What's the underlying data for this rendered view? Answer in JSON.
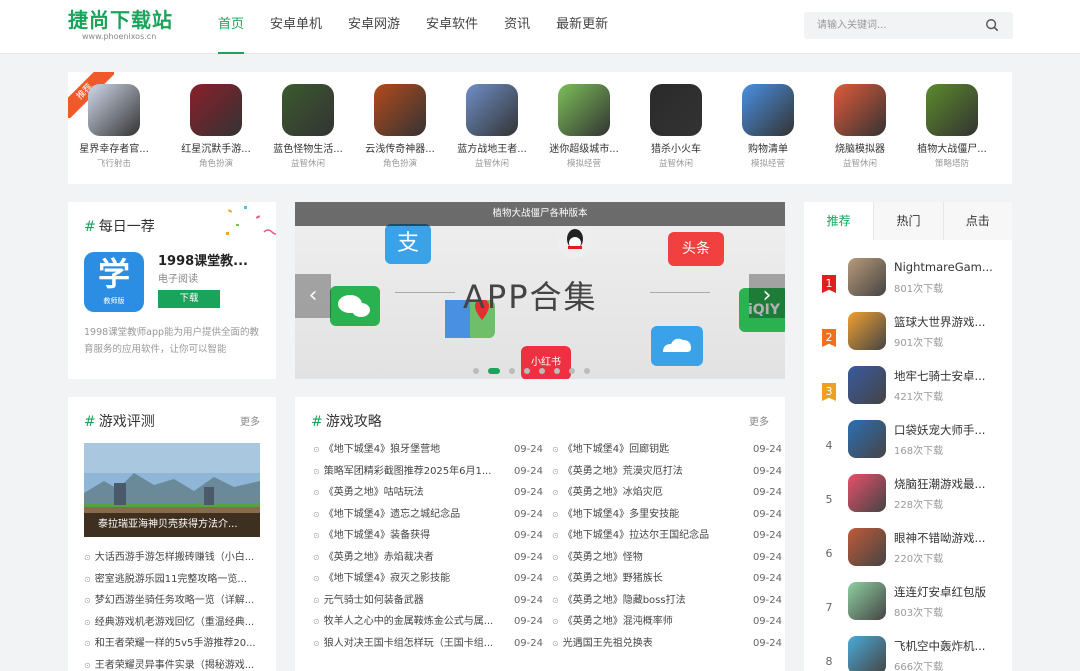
{
  "site": {
    "logo_text": "捷尚下载站",
    "logo_url_text": "www.phoenixos.cn"
  },
  "nav": {
    "items": [
      "首页",
      "安卓单机",
      "安卓网游",
      "安卓软件",
      "资讯",
      "最新更新"
    ],
    "active": 0
  },
  "search": {
    "placeholder": "请输入关键词..."
  },
  "featured": {
    "ribbon": "推荐",
    "apps": [
      {
        "name": "星界幸存者官...",
        "cat": "飞行射击",
        "color": "#cfd8ea"
      },
      {
        "name": "红星沉默手游...",
        "cat": "角色扮演",
        "color": "#8a1f2a"
      },
      {
        "name": "蓝色怪物生活...",
        "cat": "益智休闲",
        "color": "#3b5a2e"
      },
      {
        "name": "云浅传奇神器...",
        "cat": "角色扮演",
        "color": "#b34a1c"
      },
      {
        "name": "蓝方战地王者...",
        "cat": "益智休闲",
        "color": "#6f8fc7"
      },
      {
        "name": "迷你超级城市...",
        "cat": "模拟经营",
        "color": "#7bbf5a"
      },
      {
        "name": "猎杀小火车",
        "cat": "益智休闲",
        "color": "#2a2a2a"
      },
      {
        "name": "购物清单",
        "cat": "模拟经营",
        "color": "#4a90e2"
      },
      {
        "name": "烧脑模拟器",
        "cat": "益智休闲",
        "color": "#e05a3a"
      },
      {
        "name": "植物大战僵尸...",
        "cat": "策略塔防",
        "color": "#5b8a2c"
      }
    ]
  },
  "daily": {
    "title": "每日一荐",
    "app_name": "1998课堂教...",
    "app_cat": "电子阅读",
    "download": "下载",
    "icon_text": "学",
    "icon_sub": "教师版",
    "desc": "1998课堂教师app能为用户提供全面的教育服务的应用软件，让你可以智能"
  },
  "banner": {
    "caption": "植物大战僵尸各种版本",
    "title": "APP合集",
    "prev": "‹",
    "next": "›",
    "dots": 8,
    "active_dot": 1,
    "badge_toutiao": "头条",
    "badge_xhs": "小红书"
  },
  "rank": {
    "tabs": [
      "推荐",
      "热门",
      "点击"
    ],
    "active": 0,
    "items": [
      {
        "num": "1",
        "name": "NightmareGam...",
        "dl": "801次下载",
        "color": "#b89a7a"
      },
      {
        "num": "2",
        "name": "篮球大世界游戏...",
        "dl": "901次下载",
        "color": "#f0a030"
      },
      {
        "num": "3",
        "name": "地牢七骑士安卓...",
        "dl": "421次下载",
        "color": "#3a5aa0"
      },
      {
        "num": "4",
        "name": "口袋妖宠大师手...",
        "dl": "168次下载",
        "color": "#2d6fb5"
      },
      {
        "num": "5",
        "name": "烧脑狂潮游戏最...",
        "dl": "228次下载",
        "color": "#e8506a"
      },
      {
        "num": "6",
        "name": "眼神不错呦游戏...",
        "dl": "220次下载",
        "color": "#c05a3a"
      },
      {
        "num": "7",
        "name": "连连灯安卓红包版",
        "dl": "803次下载",
        "color": "#8fd0a0"
      },
      {
        "num": "8",
        "name": "飞机空中轰炸机...",
        "dl": "666次下载",
        "color": "#4aaad8"
      }
    ],
    "badge_colors": [
      "#e02020",
      "#f07020",
      "#f0a020"
    ]
  },
  "reviews": {
    "title": "游戏评测",
    "more": "更多",
    "image_caption": "泰拉瑞亚海神贝壳获得方法介...",
    "list": [
      "大话西游手游怎样搬砖赚钱（小白...",
      "密室逃脱游乐园11完整攻略一览...",
      "梦幻西游坐骑任务攻略一览（详解...",
      "经典游戏机老游戏回忆（重温经典...",
      "和王者荣耀一样的5v5手游推荐20...",
      "王者荣耀灵异事件实录（揭秘游戏..."
    ]
  },
  "guides": {
    "title": "游戏攻略",
    "more": "更多",
    "left": [
      {
        "title": "《地下城堡4》狼牙堡营地",
        "date": "09-24"
      },
      {
        "title": "策略军团精彩截图推荐2025年6月1...",
        "date": "09-24"
      },
      {
        "title": "《英勇之地》咕咕玩法",
        "date": "09-24"
      },
      {
        "title": "《地下城堡4》遗忘之城纪念品",
        "date": "09-24"
      },
      {
        "title": "《地下城堡4》装备获得",
        "date": "09-24"
      },
      {
        "title": "《英勇之地》赤焰裁决者",
        "date": "09-24"
      },
      {
        "title": "《地下城堡4》寂灭之影技能",
        "date": "09-24"
      },
      {
        "title": "元气骑士如何装备武器",
        "date": "09-24"
      },
      {
        "title": "牧羊人之心中的金属鞍炼金公式与属...",
        "date": "09-24"
      },
      {
        "title": "狼人对决王国卡组怎样玩（王国卡组...",
        "date": "09-24"
      }
    ],
    "right": [
      {
        "title": "《地下城堡4》回廊钥匙",
        "date": "09-24"
      },
      {
        "title": "《英勇之地》荒漠灾厄打法",
        "date": "09-24"
      },
      {
        "title": "《英勇之地》冰焰灾厄",
        "date": "09-24"
      },
      {
        "title": "《地下城堡4》多里安技能",
        "date": "09-24"
      },
      {
        "title": "《地下城堡4》拉达尔王国纪念品",
        "date": "09-24"
      },
      {
        "title": "《英勇之地》怪物",
        "date": "09-24"
      },
      {
        "title": "《英勇之地》野猪族长",
        "date": "09-24"
      },
      {
        "title": "《英勇之地》隐藏boss打法",
        "date": "09-24"
      },
      {
        "title": "《英勇之地》混沌概率师",
        "date": "09-24"
      },
      {
        "title": "光遇国王先祖兑换表",
        "date": "09-24"
      }
    ]
  }
}
